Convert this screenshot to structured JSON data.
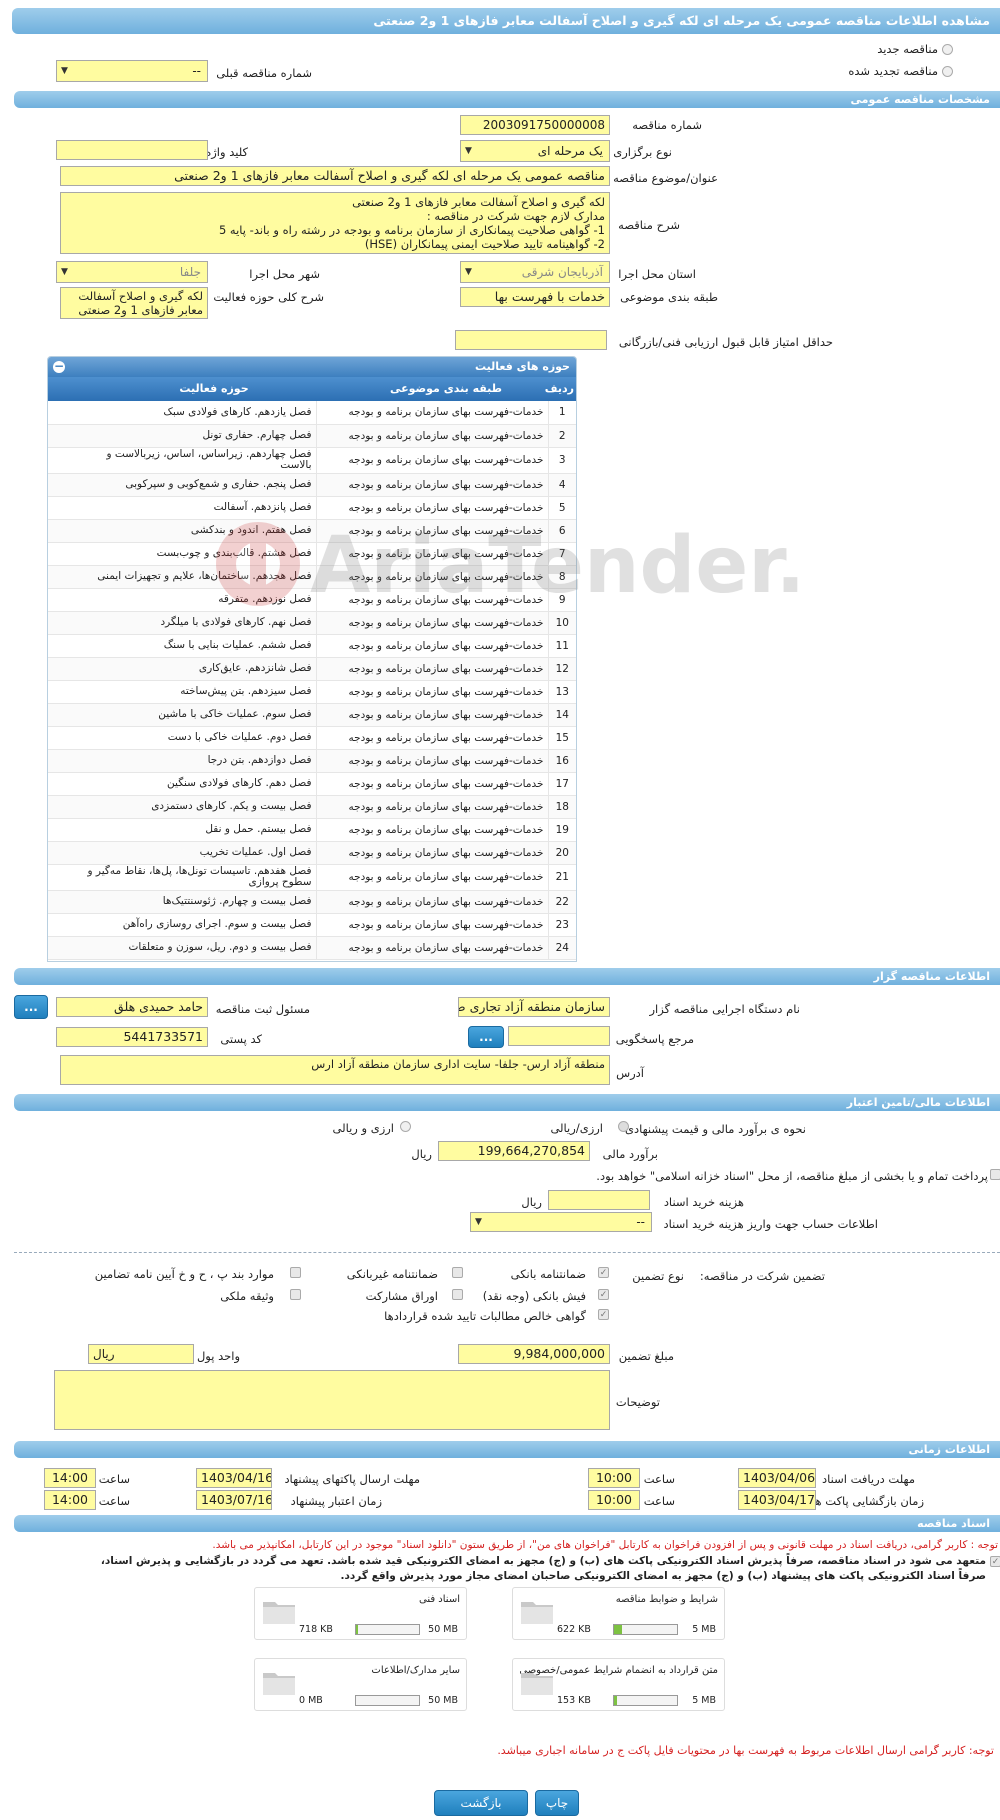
{
  "header": {
    "title": "مشاهده اطلاعات مناقصه عمومی یک مرحله ای لکه گیری و اصلاح آسفالت معابر فازهای 1 و2 صنعتی"
  },
  "type_choice": {
    "new": "مناقصه جدید",
    "renewed": "مناقصه تجدید شده",
    "prev_label": "شماره مناقصه قبلی",
    "prev_value": "--"
  },
  "general": {
    "section": "مشخصات مناقصه عمومی",
    "number_label": "شماره مناقصه",
    "number": "2003091750000008",
    "type_label": "نوع برگزاری",
    "type": "یک مرحله ای",
    "keyword_label": "کلید واژه",
    "keyword": "",
    "subject_label": "عنوان/موضوع مناقصه",
    "subject": "مناقصه عمومی یک مرحله ای لکه گیری و اصلاح آسفالت معابر فازهای 1 و2 صنعتی",
    "desc_label": "شرح مناقصه",
    "desc_lines": [
      "لکه گیری و اصلاح آسفالت معابر فازهای 1 و2 صنعتی",
      "مدارک لازم جهت شرکت در مناقصه :",
      "1-     گواهی صلاحیت پیمانکاری از سازمان برنامه و بودجه در رشته راه و باند- پایه 5",
      "2-     گواهینامه تایید صلاحیت ایمنی پیمانکاران (HSE)"
    ],
    "province_label": "استان محل اجرا",
    "province": "آذربایجان شرقی",
    "city_label": "شهر محل اجرا",
    "city": "جلفا",
    "category_label": "طبقه بندی موضوعی",
    "category": "خدمات با فهرست بها",
    "scope_label": "شرح کلی حوزه فعالیت",
    "scope_lines": [
      "لکه گیری و اصلاح آسفالت",
      "معابر فازهای 1 و2 صنعتی"
    ],
    "min_score_label": "حداقل امتیاز قابل قبول ارزیابی فنی/بازرگانی",
    "min_score": ""
  },
  "activities": {
    "title": "حوزه های فعالیت",
    "col_row": "ردیف",
    "col_cat": "طبقه بندی موضوعی",
    "col_act": "حوزه فعالیت",
    "rows": [
      {
        "n": "1",
        "cat": "خدمات-فهرست بهای سازمان برنامه و بودجه",
        "act": [
          "فصل یازدهم. کارهای فولادی سبک"
        ]
      },
      {
        "n": "2",
        "cat": "خدمات-فهرست بهای سازمان برنامه و بودجه",
        "act": [
          "فصل چهارم. حفاری تونل"
        ]
      },
      {
        "n": "3",
        "cat": "خدمات-فهرست بهای سازمان برنامه و بودجه",
        "act": [
          "فصل چهاردهم. زیراساس، اساس، زیربالاست  و",
          "بالاست"
        ]
      },
      {
        "n": "4",
        "cat": "خدمات-فهرست بهای سازمان برنامه و بودجه",
        "act": [
          "فصل پنجم. حفاری و شمع‌کوبی و سپرکوبی"
        ]
      },
      {
        "n": "5",
        "cat": "خدمات-فهرست بهای سازمان برنامه و بودجه",
        "act": [
          "فصل پانزدهم. آسفالت"
        ]
      },
      {
        "n": "6",
        "cat": "خدمات-فهرست بهای سازمان برنامه و بودجه",
        "act": [
          "فصل هفتم. اندود و بندکشی"
        ]
      },
      {
        "n": "7",
        "cat": "خدمات-فهرست بهای سازمان برنامه و بودجه",
        "act": [
          "فصل هشتم. قالب‌بندی و چوب‌بست"
        ]
      },
      {
        "n": "8",
        "cat": "خدمات-فهرست بهای سازمان برنامه و بودجه",
        "act": [
          "فصل هجدهم. ساختمان‌ها، علایم و تجهیزات ایمنی"
        ]
      },
      {
        "n": "9",
        "cat": "خدمات-فهرست بهای سازمان برنامه و بودجه",
        "act": [
          "فصل نوزدهم. متفرقه"
        ]
      },
      {
        "n": "10",
        "cat": "خدمات-فهرست بهای سازمان برنامه و بودجه",
        "act": [
          "فصل نهم. کارهای فولادی با میلگرد"
        ]
      },
      {
        "n": "11",
        "cat": "خدمات-فهرست بهای سازمان برنامه و بودجه",
        "act": [
          "فصل ششم. عملیات بنایی با سنگ"
        ]
      },
      {
        "n": "12",
        "cat": "خدمات-فهرست بهای سازمان برنامه و بودجه",
        "act": [
          "فصل شانزدهم. عایق‌کاری"
        ]
      },
      {
        "n": "13",
        "cat": "خدمات-فهرست بهای سازمان برنامه و بودجه",
        "act": [
          "فصل سیزدهم. بتن پیش‌ساخته"
        ]
      },
      {
        "n": "14",
        "cat": "خدمات-فهرست بهای سازمان برنامه و بودجه",
        "act": [
          "فصل سوم. عملیات خاکی با ماشین"
        ]
      },
      {
        "n": "15",
        "cat": "خدمات-فهرست بهای سازمان برنامه و بودجه",
        "act": [
          "فصل دوم. عملیات خاکی با دست"
        ]
      },
      {
        "n": "16",
        "cat": "خدمات-فهرست بهای سازمان برنامه و بودجه",
        "act": [
          "فصل دوازدهم. بتن درجا"
        ]
      },
      {
        "n": "17",
        "cat": "خدمات-فهرست بهای سازمان برنامه و بودجه",
        "act": [
          "فصل دهم. کارهای فولادی سنگین"
        ]
      },
      {
        "n": "18",
        "cat": "خدمات-فهرست بهای سازمان برنامه و بودجه",
        "act": [
          "فصل بیست و یکم. کارهای دستمزدی"
        ]
      },
      {
        "n": "19",
        "cat": "خدمات-فهرست بهای سازمان برنامه و بودجه",
        "act": [
          "فصل بیستم. حمل و نقل"
        ]
      },
      {
        "n": "20",
        "cat": "خدمات-فهرست بهای سازمان برنامه و بودجه",
        "act": [
          "فصل اول. عملیات تخریب"
        ]
      },
      {
        "n": "21",
        "cat": "خدمات-فهرست بهای سازمان برنامه و بودجه",
        "act": [
          "فصل هفدهم. تاسیسات تونل‌ها، پل‌ها، نقاط مه‌گیر و",
          "سطوح پروازی"
        ]
      },
      {
        "n": "22",
        "cat": "خدمات-فهرست بهای سازمان برنامه و بودجه",
        "act": [
          "فصل بیست و چهارم. ژئوسنتتیک‌ها"
        ]
      },
      {
        "n": "23",
        "cat": "خدمات-فهرست بهای سازمان برنامه و بودجه",
        "act": [
          "فصل بیست و سوم. اجرای روسازی راه‌آهن"
        ]
      },
      {
        "n": "24",
        "cat": "خدمات-فهرست بهای سازمان برنامه و بودجه",
        "act": [
          "فصل بیست و دوم. ریل، سوزن و متعلقات"
        ]
      }
    ]
  },
  "watermark": "AriaTender.neT",
  "organizer": {
    "section": "اطلاعات مناقصه گزار",
    "org_label": "نام دستگاه اجرایی مناقصه گزار",
    "org": "سازمان منطقه آزاد تجاری صنعتی ارس",
    "resp_label": "مسئول ثبت مناقصه",
    "resp": "حامد حمیدی هلق",
    "dots": "...",
    "ref_label": "مرجع پاسخگویی",
    "ref": "",
    "postal_label": "کد پستی",
    "postal": "5441733571",
    "addr_label": "آدرس",
    "addr": "منطقه آزاد ارس- جلفا- سایت اداری سازمان منطقه آزاد ارس"
  },
  "finance": {
    "section": "اطلاعات مالی/تامین اعتبار",
    "method_label": "نحوه ی برآورد مالی و قیمت پیشنهادی",
    "opt1": "ارزی/ریالی",
    "opt2": "ارزی و ریالی",
    "estimate_label": "برآورد مالی",
    "estimate": "199,664,270,854",
    "rial": "ریال",
    "treasury": "پرداخت تمام و یا بخشی از مبلغ مناقصه، از محل \"اسناد خزانه اسلامی\" خواهد بود.",
    "doc_cost_label": "هزینه خرید اسناد",
    "doc_cost": "",
    "account_label": "اطلاعات حساب جهت واریز هزینه خرید اسناد",
    "account": "--",
    "guarantee_title": "تضمین شرکت در مناقصه:",
    "guarantee_type": "نوع تضمین",
    "g1": "ضمانتنامه بانکی",
    "g2": "ضمانتنامه غیربانکی",
    "g3": "موارد بند پ ، ح و خ آیین نامه تضامین",
    "g4": "فیش بانکی (وجه نقد)",
    "g5": "اوراق مشارکت",
    "g6": "وثیقه ملکی",
    "g7": "گواهی خالص مطالبات تایید شده قراردادها",
    "amount_label": "مبلغ تضمین",
    "amount": "9,984,000,000",
    "currency_label": "واحد پول",
    "currency": "ریال",
    "notes_label": "توضیحات",
    "notes": ""
  },
  "timing": {
    "section": "اطلاعات زمانی",
    "recv_label": "مهلت دریافت اسناد",
    "recv_date": "1403/04/06",
    "recv_time": "10:00",
    "send_label": "مهلت ارسال پاکتهای پیشنهاد",
    "send_date": "1403/04/16",
    "send_time": "14:00",
    "open_label": "زمان بازگشایی پاکت ها",
    "open_date": "1403/04/17",
    "open_time": "10:00",
    "valid_label": "زمان اعتبار پیشنهاد",
    "valid_date": "1403/07/16",
    "valid_time": "14:00",
    "time_label": "ساعت"
  },
  "documents": {
    "section": "اسناد مناقصه",
    "note1": "توجه : کاربر گرامی، دریافت اسناد در مهلت قانونی و پس از افزودن فراخوان به کارتابل \"فراخوان های من\"، از طریق ستون \"دانلود اسناد\" موجود در این کارتابل، امکانپذیر می باشد.",
    "note2": "متعهد می شود در اسناد مناقصه، صرفاً پذیرش اسناد الکترونیکی پاکت های (ب) و (ج) مجهز به امضای الکترونیکی قید شده باشد. تعهد می گردد در بازگشایی و پذیرش اسناد،",
    "note3": "صرفاً اسناد الکترونیکی پاکت های پیشنهاد (ب) و (ج) مجهز به امضای الکترونیکی صاحبان امضای مجاز مورد پذیرش واقع گردد.",
    "tiles": [
      {
        "name": "شرایط و ضوابط مناقصه",
        "val": "622 KB",
        "max": "5 MB",
        "fill": 0.12
      },
      {
        "name": "اسناد فنی",
        "val": "718 KB",
        "max": "50 MB",
        "fill": 0.03
      },
      {
        "name": "متن قرارداد به انضمام شرایط عمومی/خصوصی",
        "val": "153 KB",
        "max": "5 MB",
        "fill": 0.04
      },
      {
        "name": "سایر مدارک/اطلاعات",
        "val": "0 MB",
        "max": "50 MB",
        "fill": 0.0
      }
    ],
    "note4": "توجه: کاربر گرامی ارسال اطلاعات مربوط به فهرست بها در محتویات فایل پاکت ج در سامانه اجباری میباشد."
  },
  "footer": {
    "back": "بازگشت",
    "print": "چاپ"
  }
}
